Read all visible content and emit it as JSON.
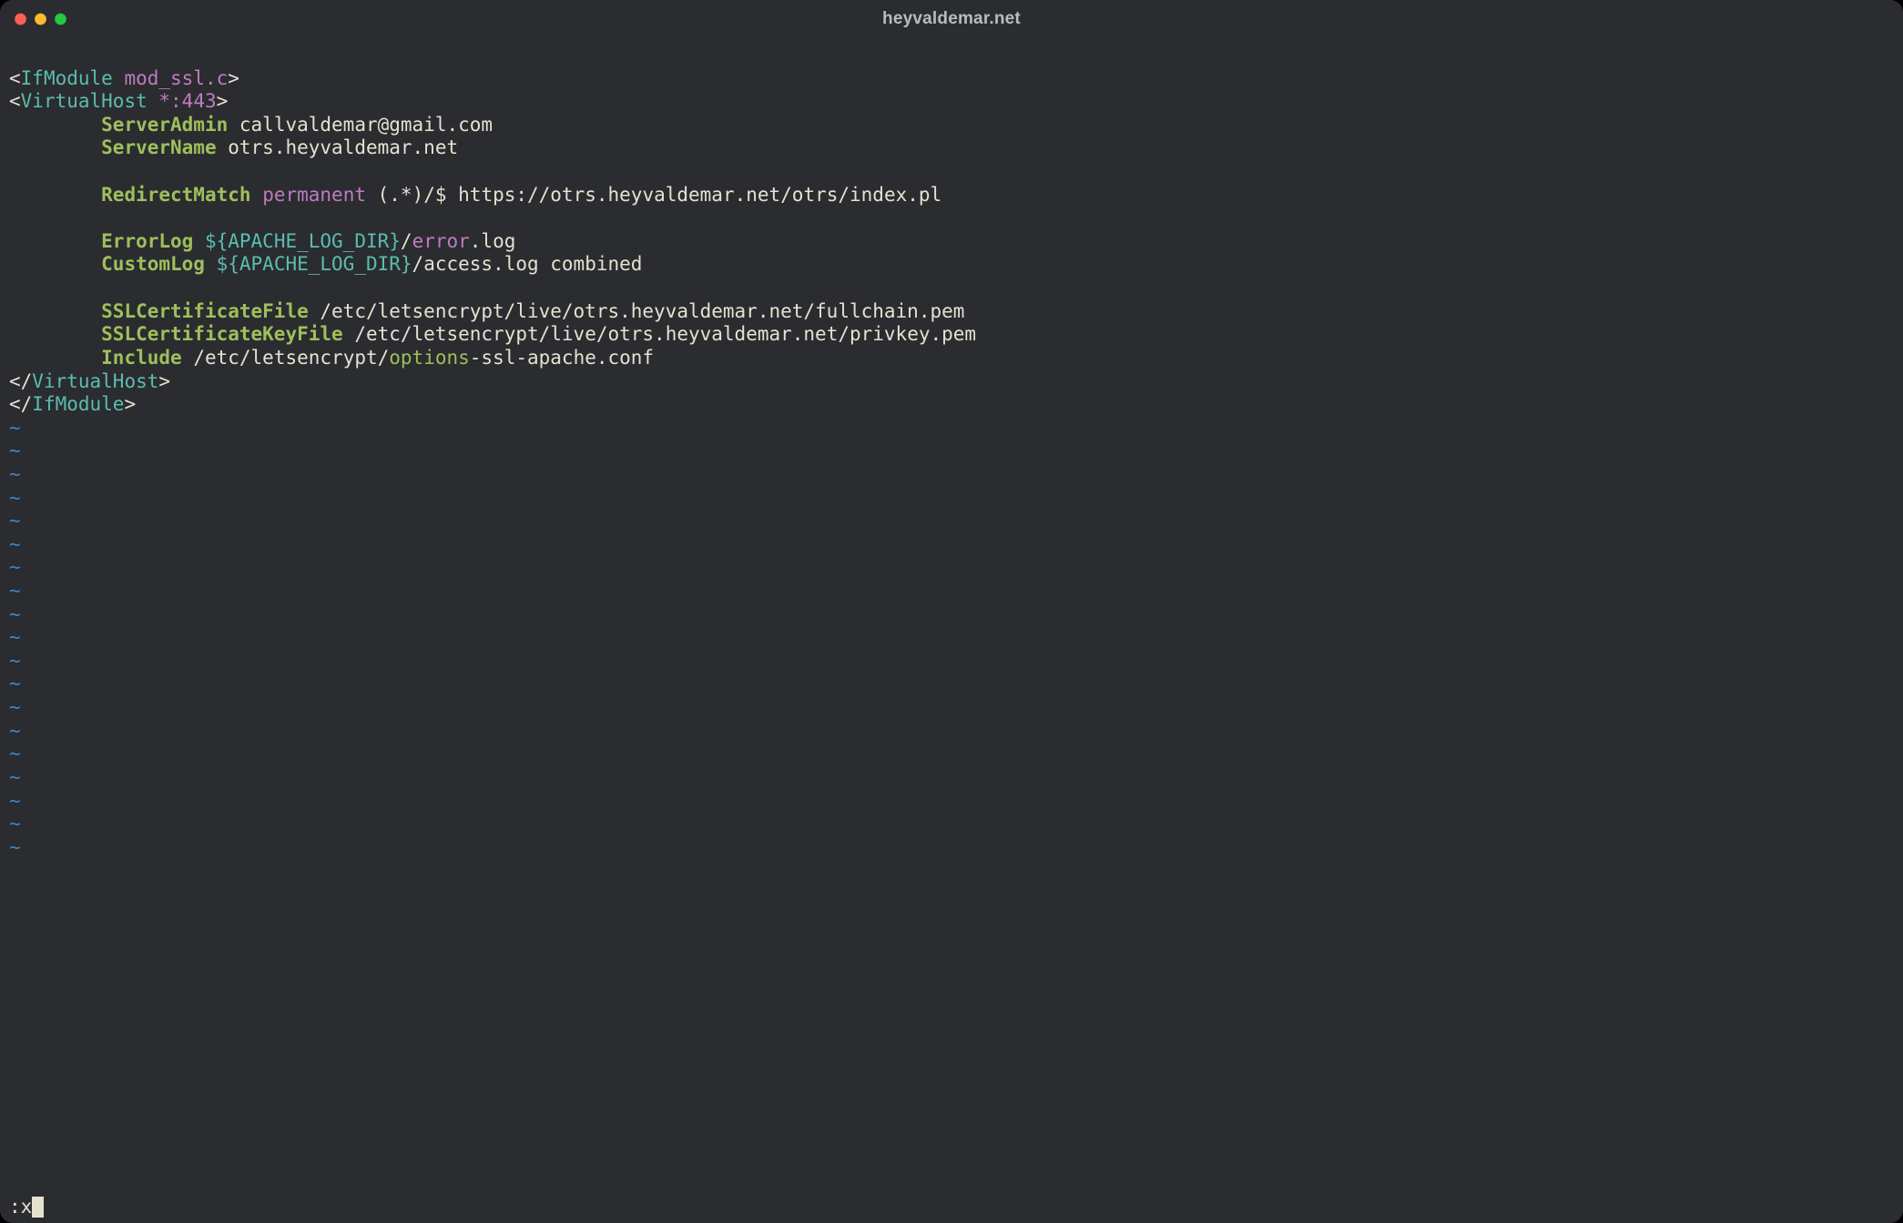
{
  "window": {
    "title": "heyvaldemar.net"
  },
  "colors": {
    "bg": "#2a2c30",
    "fg": "#e6e1cf",
    "tag": "#5bbdad",
    "keyword": "#9fbf5b",
    "attr": "#c07bbf",
    "tilde": "#3f84c6"
  },
  "vim": {
    "command": ":x",
    "tilde_char": "~",
    "tilde_rows": 19
  },
  "config": {
    "ifmodule_open": {
      "lt": "<",
      "name": "IfModule",
      "arg": "mod_ssl.c",
      "gt": ">"
    },
    "vhost_open": {
      "lt": "<",
      "name": "VirtualHost",
      "arg": "*:443",
      "gt": ">"
    },
    "server_admin": {
      "directive": "ServerAdmin",
      "value": "callvaldemar@gmail.com"
    },
    "server_name": {
      "directive": "ServerName",
      "value": "otrs.heyvaldemar.net"
    },
    "redirect": {
      "directive": "RedirectMatch",
      "flag": "permanent",
      "pattern": "(.*)/$",
      "target": "https://otrs.heyvaldemar.net/otrs/index.pl"
    },
    "error_log": {
      "directive": "ErrorLog",
      "var": "${APACHE_LOG_DIR}",
      "slash": "/",
      "word": "error",
      "ext": ".log"
    },
    "custom_log": {
      "directive": "CustomLog",
      "var": "${APACHE_LOG_DIR}",
      "rest": "/access.log combined"
    },
    "ssl_cert": {
      "directive": "SSLCertificateFile",
      "value": "/etc/letsencrypt/live/otrs.heyvaldemar.net/fullchain.pem"
    },
    "ssl_key": {
      "directive": "SSLCertificateKeyFile",
      "value": "/etc/letsencrypt/live/otrs.heyvaldemar.net/privkey.pem"
    },
    "include": {
      "directive": "Include",
      "prefix": "/etc/letsencrypt/",
      "word": "options",
      "suffix": "-ssl-apache.conf"
    },
    "vhost_close": {
      "lt": "</",
      "name": "VirtualHost",
      "gt": ">"
    },
    "ifmodule_close": {
      "lt": "</",
      "name": "IfModule",
      "gt": ">"
    }
  }
}
